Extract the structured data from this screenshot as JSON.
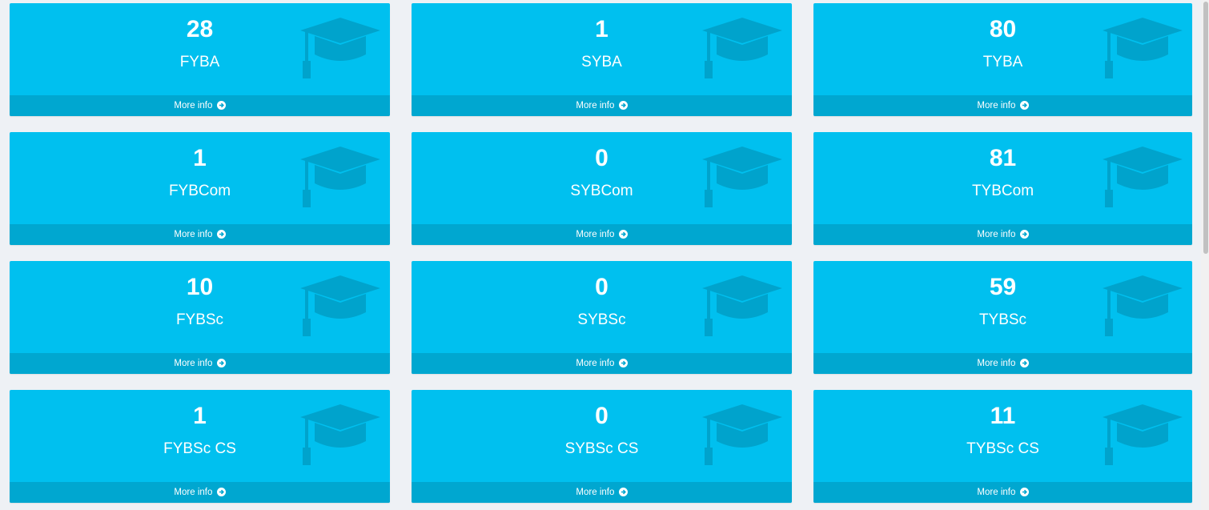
{
  "cards": [
    {
      "count": "28",
      "label": "FYBA",
      "link": "More info"
    },
    {
      "count": "1",
      "label": "SYBA",
      "link": "More info"
    },
    {
      "count": "80",
      "label": "TYBA",
      "link": "More info"
    },
    {
      "count": "1",
      "label": "FYBCom",
      "link": "More info"
    },
    {
      "count": "0",
      "label": "SYBCom",
      "link": "More info"
    },
    {
      "count": "81",
      "label": "TYBCom",
      "link": "More info"
    },
    {
      "count": "10",
      "label": "FYBSc",
      "link": "More info"
    },
    {
      "count": "0",
      "label": "SYBSc",
      "link": "More info"
    },
    {
      "count": "59",
      "label": "TYBSc",
      "link": "More info"
    },
    {
      "count": "1",
      "label": "FYBSc CS",
      "link": "More info"
    },
    {
      "count": "0",
      "label": "SYBSc CS",
      "link": "More info"
    },
    {
      "count": "11",
      "label": "TYBSc CS",
      "link": "More info"
    }
  ],
  "icons": {
    "card_icon": "graduation-cap-icon",
    "footer_icon": "arrow-circle-right-icon"
  },
  "colors": {
    "card_bg": "#00c0ef",
    "footer_bg": "#00a7d0",
    "icon": "#00a3cc",
    "page_bg": "#eef1f5"
  }
}
